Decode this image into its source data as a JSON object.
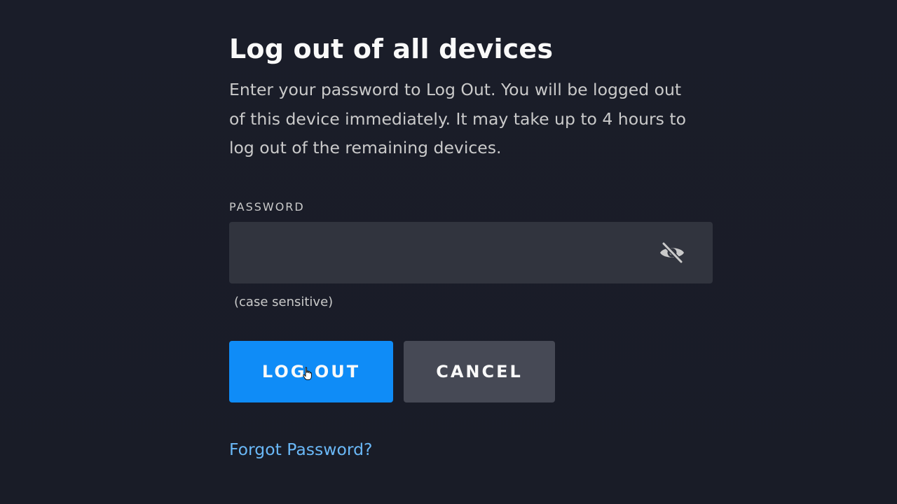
{
  "dialog": {
    "title": "Log out of all devices",
    "description": "Enter your password to Log Out. You will be logged out of this device immediately. It may take up to 4 hours to log out of the remaining devices.",
    "password": {
      "label": "PASSWORD",
      "value": "",
      "placeholder": "",
      "hint": "(case sensitive)",
      "toggle_icon": "eye-slash-icon"
    },
    "buttons": {
      "logout_label": "LOG OUT",
      "cancel_label": "CANCEL"
    },
    "forgot_password_label": "Forgot Password?"
  },
  "colors": {
    "background": "#1a1d29",
    "field_background": "#31343e",
    "primary_button": "#0f8cf7",
    "secondary_button": "#464955",
    "link": "#6ab8f7"
  }
}
